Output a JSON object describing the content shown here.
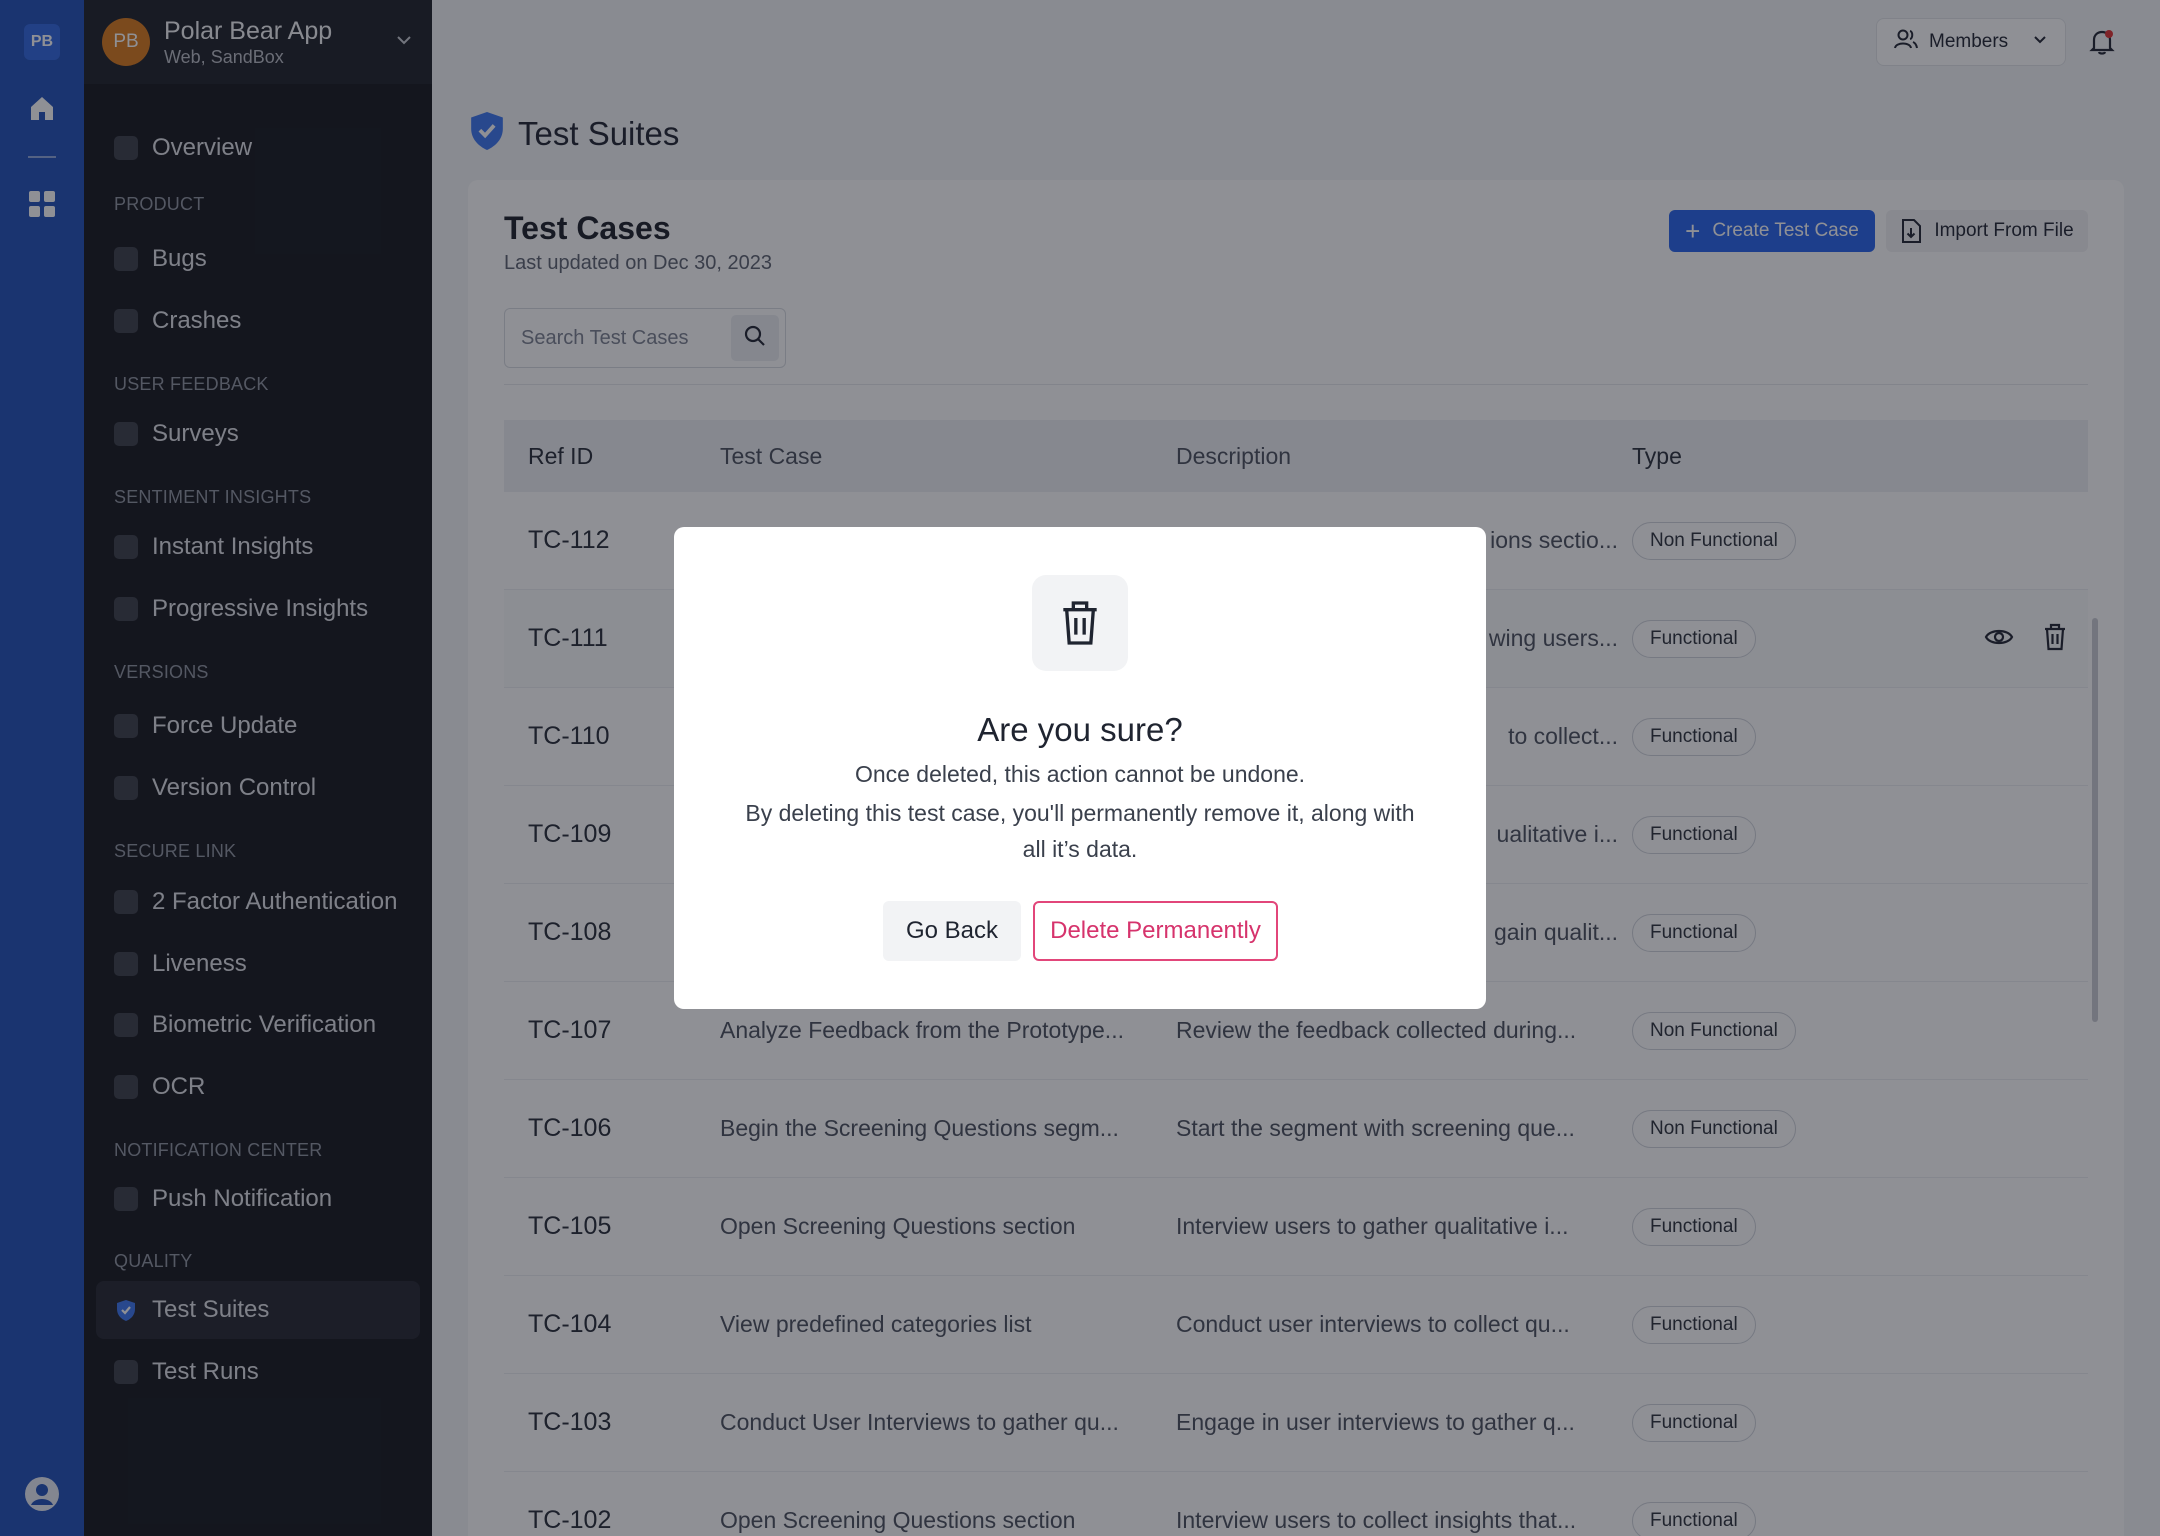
{
  "rail": {
    "logo": "PB"
  },
  "app": {
    "avatar": "PB",
    "name": "Polar Bear App",
    "env": "Web, SandBox"
  },
  "sidebar": {
    "overview": "Overview",
    "sections": {
      "product": "PRODUCT",
      "user_feedback": "USER FEEDBACK",
      "sentiment": "SENTIMENT INSIGHTS",
      "versions": "VERSIONS",
      "secure_link": "SECURE LINK",
      "notification": "NOTIFICATION CENTER",
      "quality": "QUALITY"
    },
    "items": {
      "bugs": "Bugs",
      "crashes": "Crashes",
      "surveys": "Surveys",
      "instant": "Instant Insights",
      "progressive": "Progressive Insights",
      "force_update": "Force Update",
      "version_control": "Version Control",
      "twofa": "2 Factor Authentication",
      "liveness": "Liveness",
      "biometric": "Biometric Verification",
      "ocr": "OCR",
      "push": "Push Notification",
      "test_suites": "Test Suites",
      "test_runs": "Test Runs"
    }
  },
  "topbar": {
    "members": "Members"
  },
  "page": {
    "title": "Test Suites"
  },
  "card": {
    "title": "Test Cases",
    "subtitle": "Last updated on Dec 30, 2023",
    "create_label": "Create Test Case",
    "import_label": "Import From File",
    "search_placeholder": "Search Test Cases"
  },
  "table": {
    "headers": {
      "ref": "Ref ID",
      "case": "Test Case",
      "desc": "Description",
      "type": "Type"
    },
    "rows": [
      {
        "ref": "TC-112",
        "case": "",
        "desc": "ions sectio...",
        "type": "Non Functional"
      },
      {
        "ref": "TC-111",
        "case": "",
        "desc": "wing users...",
        "type": "Functional"
      },
      {
        "ref": "TC-110",
        "case": "",
        "desc": "to collect...",
        "type": "Functional"
      },
      {
        "ref": "TC-109",
        "case": "",
        "desc": "ualitative i...",
        "type": "Functional"
      },
      {
        "ref": "TC-108",
        "case": "",
        "desc": "gain qualit...",
        "type": "Functional"
      },
      {
        "ref": "TC-107",
        "case": "Analyze Feedback from the Prototype...",
        "desc": "Review the feedback collected during...",
        "type": "Non Functional"
      },
      {
        "ref": "TC-106",
        "case": "Begin the Screening Questions segm...",
        "desc": "Start the segment with screening que...",
        "type": "Non Functional"
      },
      {
        "ref": "TC-105",
        "case": "Open Screening Questions section",
        "desc": "Interview users to gather qualitative i...",
        "type": "Functional"
      },
      {
        "ref": "TC-104",
        "case": "View predefined categories list",
        "desc": "Conduct user interviews to collect qu...",
        "type": "Functional"
      },
      {
        "ref": "TC-103",
        "case": "Conduct User Interviews to gather qu...",
        "desc": "Engage in user interviews to gather q...",
        "type": "Functional"
      },
      {
        "ref": "TC-102",
        "case": "Open Screening Questions section",
        "desc": "Interview users to collect insights that...",
        "type": "Functional"
      }
    ]
  },
  "modal": {
    "title": "Are you sure?",
    "line1": "Once deleted, this action cannot be undone.",
    "line2": "By deleting this test case, you'll permanently remove it, along with all it’s data.",
    "back_label": "Go Back",
    "delete_label": "Delete Permanently"
  },
  "colors": {
    "primary": "#2563eb",
    "rail": "#1f4fb8",
    "sidebar": "#14161c",
    "danger": "#d6336c"
  }
}
